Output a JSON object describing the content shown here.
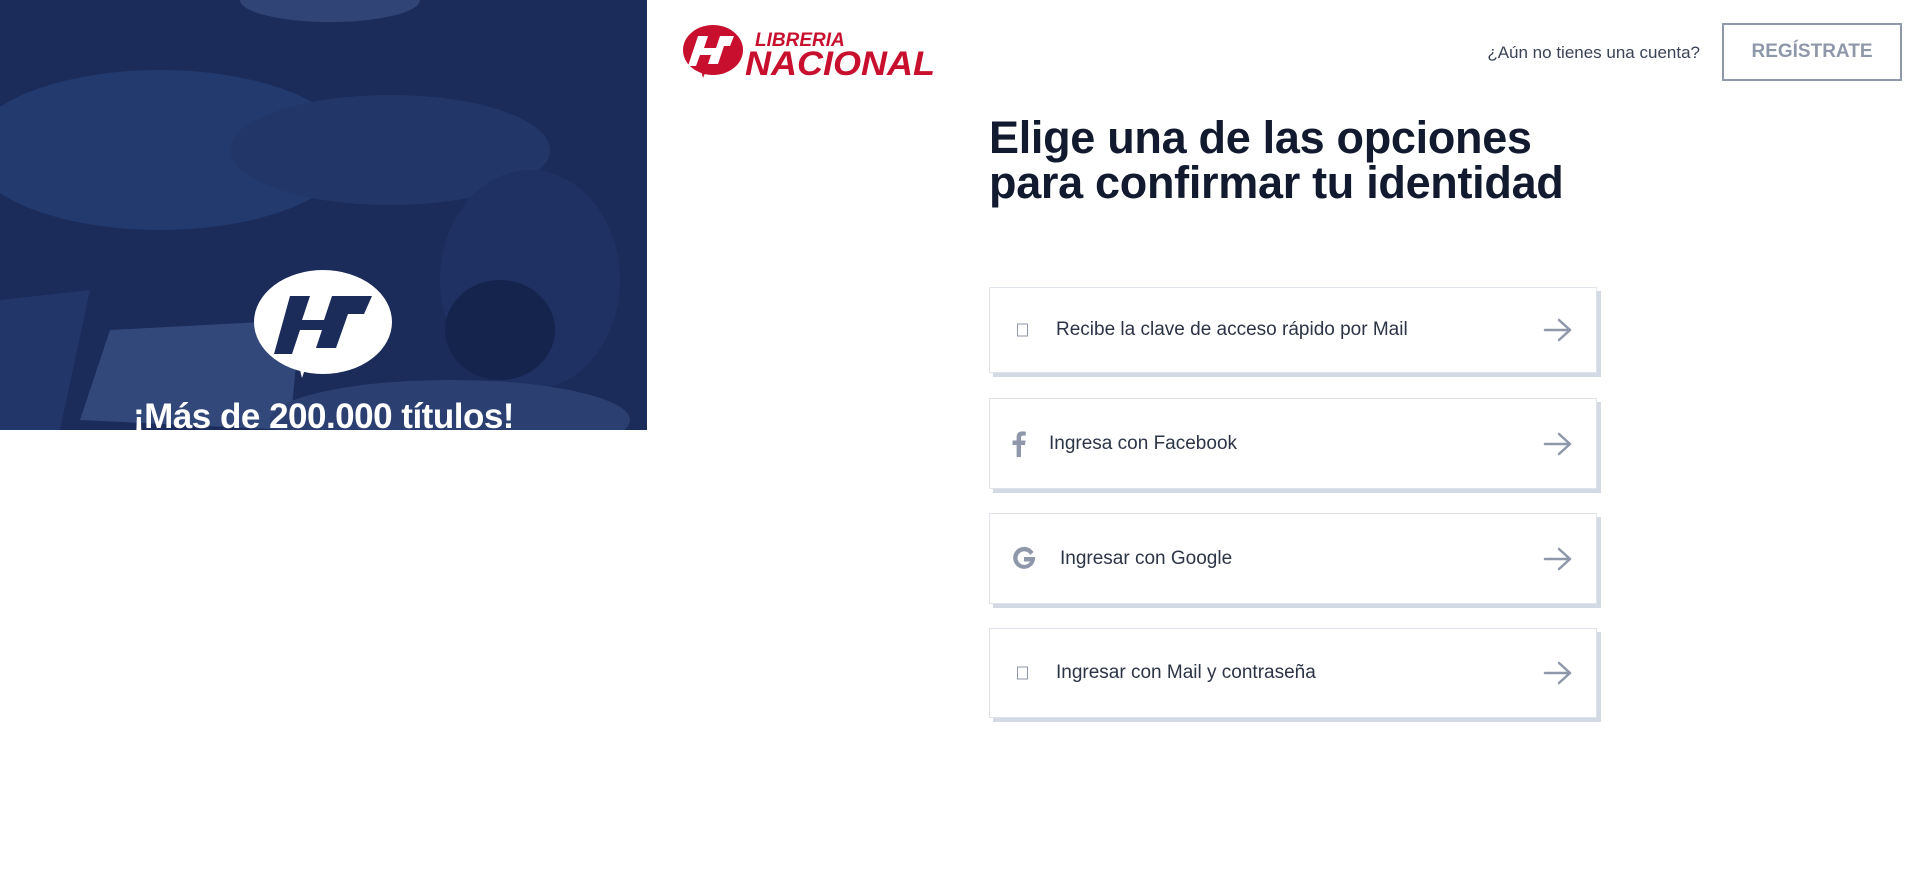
{
  "promo": {
    "tagline": "¡Más de 200.000 títulos!"
  },
  "header": {
    "brand_line1": "LIBRERIA",
    "brand_line2": "NACIONAL",
    "signup_question": "¿Aún no tienes una cuenta?",
    "signup_button": "REGÍSTRATE"
  },
  "main": {
    "title": "Elige una de las opciones para confirmar tu identidad",
    "options": [
      {
        "label": "Recibe la clave de acceso rápido por Mail",
        "icon": "mail-icon"
      },
      {
        "label": "Ingresa con Facebook",
        "icon": "facebook-icon"
      },
      {
        "label": "Ingresar con Google",
        "icon": "google-icon"
      },
      {
        "label": "Ingresar con Mail y contraseña",
        "icon": "lock-icon"
      }
    ]
  },
  "colors": {
    "brand_red": "#c8102e",
    "navy": "#1b2b5a",
    "title_text": "#111a2e",
    "muted_gray": "#8f98aa",
    "card_shadow": "#d3d9e5"
  }
}
